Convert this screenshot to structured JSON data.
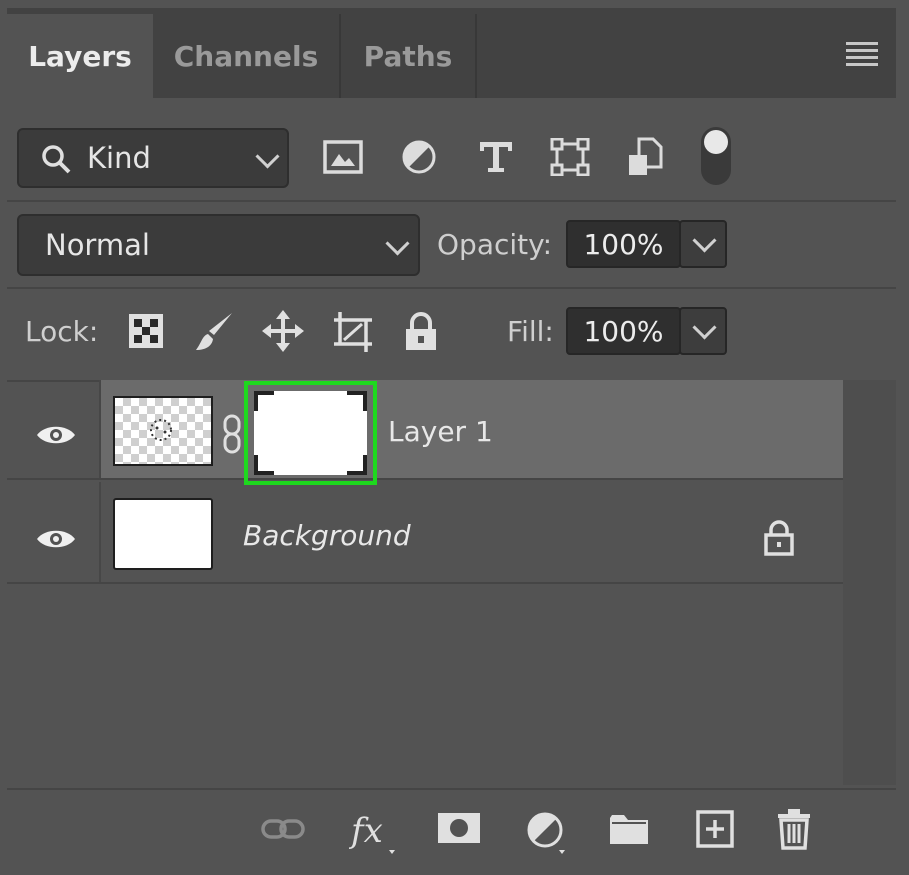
{
  "tabs": [
    {
      "label": "Layers",
      "active": true
    },
    {
      "label": "Channels",
      "active": false
    },
    {
      "label": "Paths",
      "active": false
    }
  ],
  "filter": {
    "kind_label": "Kind",
    "filter_icons": [
      "pixel-filter-icon",
      "adjustment-filter-icon",
      "type-filter-icon",
      "shape-filter-icon",
      "smart-object-filter-icon"
    ]
  },
  "blend": {
    "mode": "Normal",
    "opacity_label": "Opacity:",
    "opacity_value": "100%"
  },
  "lock": {
    "label": "Lock:",
    "fill_label": "Fill:",
    "fill_value": "100%"
  },
  "layers": [
    {
      "name": "Layer 1",
      "visible": true,
      "selected": true,
      "has_mask": true
    },
    {
      "name": "Background",
      "visible": true,
      "selected": false,
      "locked": true
    }
  ],
  "colors": {
    "panel_bg": "#535353",
    "selected_row": "#6b6b6b",
    "highlight": "#1ed81e"
  }
}
